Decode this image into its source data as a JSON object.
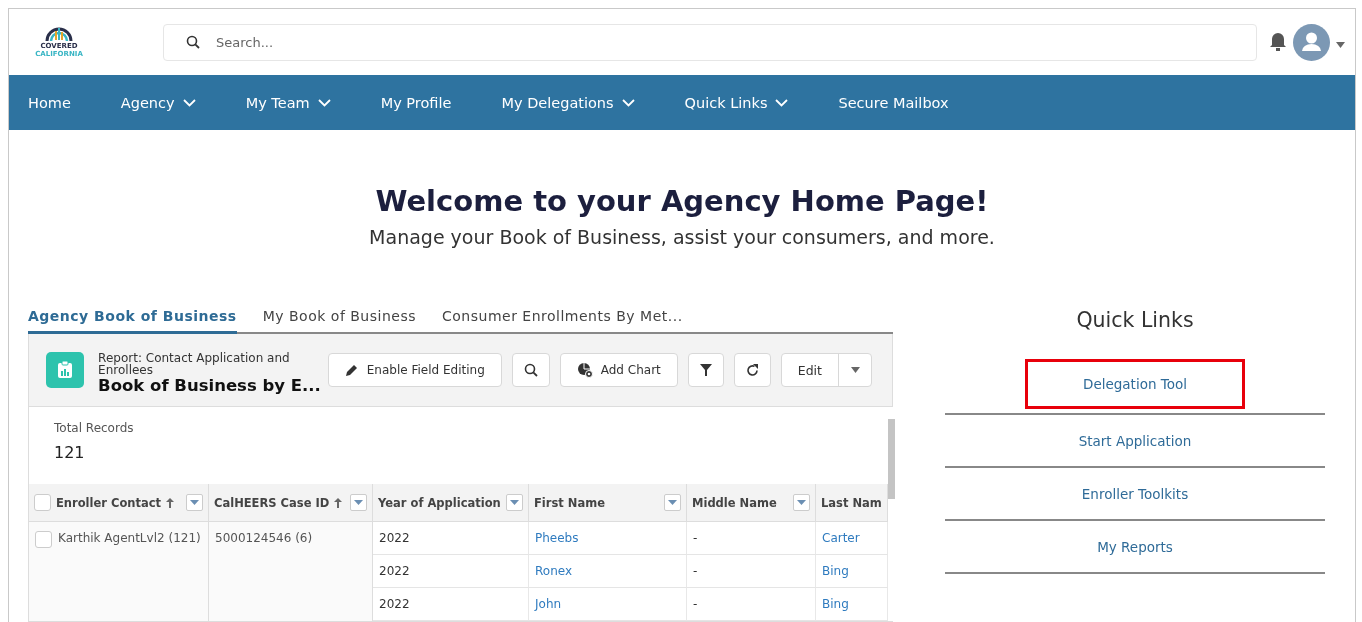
{
  "logo": {
    "line_1": "COVERED",
    "line_2": "CALIFORNIA"
  },
  "search": {
    "placeholder": "Search..."
  },
  "nav": [
    {
      "label": "Home",
      "has_menu": false
    },
    {
      "label": "Agency",
      "has_menu": true
    },
    {
      "label": "My Team",
      "has_menu": true
    },
    {
      "label": "My Profile",
      "has_menu": false
    },
    {
      "label": "My Delegations",
      "has_menu": true
    },
    {
      "label": "Quick Links",
      "has_menu": true
    },
    {
      "label": "Secure Mailbox",
      "has_menu": false
    }
  ],
  "hero": {
    "title": "Welcome to your Agency Home Page!",
    "subtitle": "Manage your Book of Business, assist your consumers, and more."
  },
  "tabs": [
    {
      "label": "Agency Book of Business",
      "selected": true
    },
    {
      "label": "My Book of Business",
      "selected": false
    },
    {
      "label": "Consumer Enrollments By Met...",
      "selected": false
    }
  ],
  "report": {
    "type_label": "Report: Contact Application and Enrollees",
    "title": "Book of Business by E...",
    "buttons": [
      {
        "kind": "text",
        "label": "Enable Field Editing"
      },
      {
        "kind": "icon"
      },
      {
        "kind": "text",
        "label": "Add Chart"
      },
      {
        "kind": "icon"
      },
      {
        "kind": "icon"
      },
      {
        "kind": "split",
        "label": "Edit"
      }
    ],
    "select_all_checked": false,
    "total_label": "Total Records",
    "total_value": "121",
    "columns": [
      {
        "label": "Enroller Contact",
        "sorted": true
      },
      {
        "label": "CalHEERS Case ID",
        "sorted": true
      },
      {
        "label": "Year of Application",
        "sorted": false
      },
      {
        "label": "First Name",
        "sorted": false
      },
      {
        "label": "Middle Name",
        "sorted": false
      },
      {
        "label": "Last Nam",
        "sorted": false
      }
    ],
    "group": {
      "enroller": "Karthik AgentLvl2 (121)",
      "checked": false,
      "case_id": "5000124546 (6)"
    },
    "rows": [
      {
        "year": "2022",
        "first": "Pheebs",
        "middle": "-",
        "last": "Carter"
      },
      {
        "year": "2022",
        "first": "Ronex",
        "middle": "-",
        "last": "Bing"
      },
      {
        "year": "2022",
        "first": "John",
        "middle": "-",
        "last": "Bing"
      }
    ]
  },
  "quick_links": {
    "title": "Quick Links",
    "items": [
      {
        "label": "Delegation Tool",
        "highlighted": true
      },
      {
        "label": "Start Application",
        "highlighted": false
      },
      {
        "label": "Enroller Toolkits",
        "highlighted": false
      },
      {
        "label": "My Reports",
        "highlighted": false
      }
    ]
  }
}
